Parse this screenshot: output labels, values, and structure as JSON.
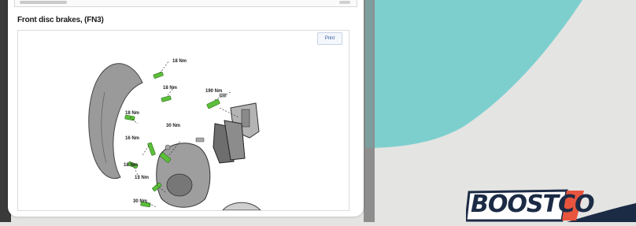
{
  "section": {
    "title": "Front disc brakes, (FN3)"
  },
  "print_button": {
    "label": "Print"
  },
  "diagram": {
    "torque_labels": [
      "18 Nm",
      "18 Nm",
      "190 Nm",
      "18 Nm",
      "30 Nm",
      "16 Nm",
      "18 Nm",
      "13 Nm",
      "30 Nm"
    ]
  },
  "logo": {
    "text": "BOOSTCO"
  },
  "colors": {
    "teal": "#7dcfce",
    "background": "#e4e4e2",
    "logo_navy": "#1c2b45",
    "logo_accent": "#e8553e",
    "bolt_green": "#5cbf3a"
  }
}
